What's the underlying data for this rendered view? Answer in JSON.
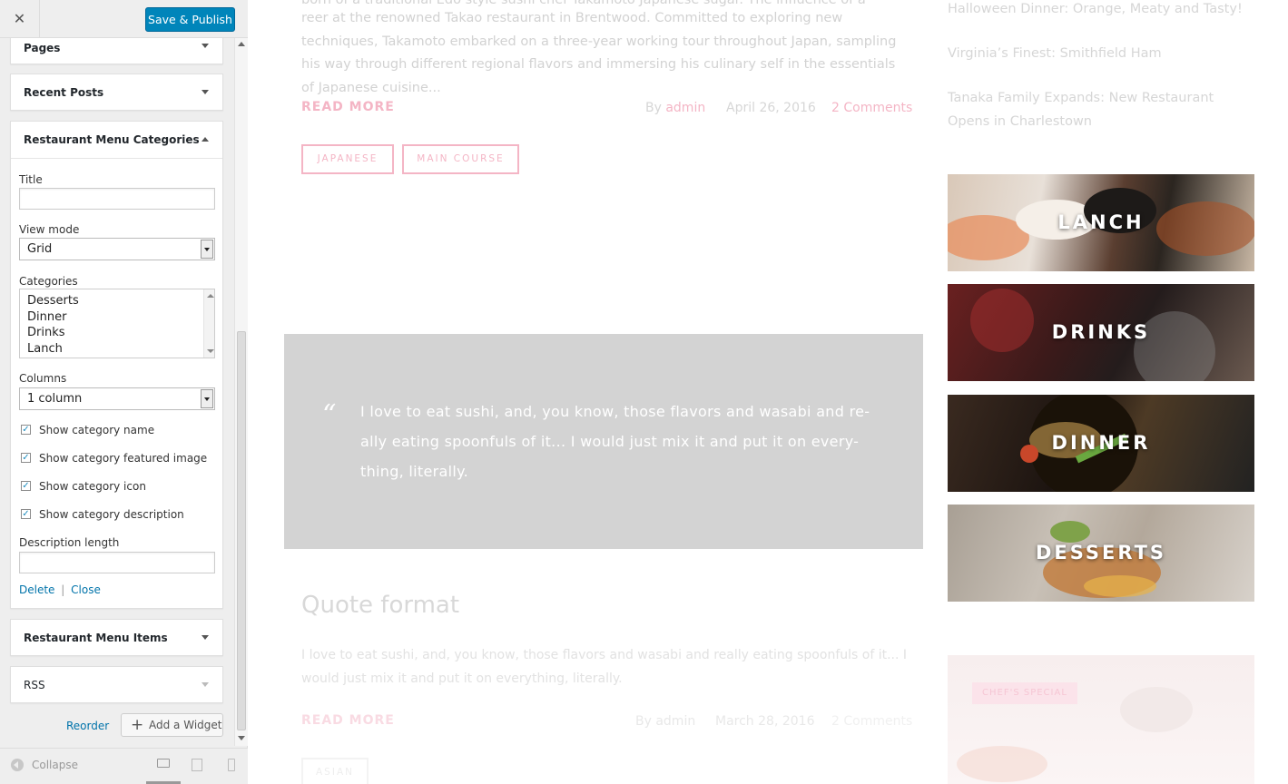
{
  "panel": {
    "close_icon": "close-icon",
    "save_label": "Save & Publish",
    "widgets": {
      "pages": "Pages",
      "recent_posts": "Recent Posts",
      "rmc": "Restaurant Menu Categories",
      "rmi": "Restaurant Menu Items",
      "rss": "RSS"
    },
    "form": {
      "title_label": "Title",
      "title_value": "",
      "view_mode_label": "View mode",
      "view_mode_value": "Grid",
      "categories_label": "Categories",
      "categories": [
        "Desserts",
        "Dinner",
        "Drinks",
        "Lanch"
      ],
      "columns_label": "Columns",
      "columns_value": "1 column",
      "checkboxes": [
        {
          "label": "Show category name",
          "checked": true
        },
        {
          "label": "Show category featured image",
          "checked": true
        },
        {
          "label": "Show category icon",
          "checked": true
        },
        {
          "label": "Show category description",
          "checked": true
        }
      ],
      "desc_length_label": "Description length",
      "desc_length_value": "",
      "delete_label": "Delete",
      "separator": "|",
      "close_label": "Close"
    },
    "reorder_label": "Reorder",
    "add_widget_label": "Add a Widget",
    "collapse_label": "Collapse",
    "device_icons": [
      "desktop-icon",
      "tablet-icon",
      "mobile-icon"
    ]
  },
  "preview": {
    "post1": {
      "excerpt_top": "born of a traditional Edo style sushi chef Takamoto Japanese sugar. The influence of a consecrated",
      "excerpt": "reer at the renowned Takao restaurant in Brentwood. Committed to exploring new techniques, Takamoto embarked on a three-year working tour throughout Japan, sampling his way through different regional flavors and immersing his culinary self in the essentials of Japanese cuisine...",
      "read_more": "READ MORE",
      "by": "By",
      "author": "admin",
      "date": "April 26, 2016",
      "comments": "2 Comments",
      "tags": [
        "JAPANESE",
        "MAIN COURSE"
      ]
    },
    "quote": {
      "mark": "“",
      "text": "I love to eat sushi, and, you know, those flavors and wasabi and re-ally eating spoonfuls of it... I would just mix it and put it on every-thing, literally."
    },
    "post2": {
      "title": "Quote format",
      "excerpt": "I love to eat sushi, and, you know, those flavors and wasabi and really eating spoonfuls of it... I would just mix it and put it on everything, literally.",
      "read_more": "READ MORE",
      "meta": "By admin",
      "date": "March 28, 2016",
      "comments": "2 Comments",
      "tag": "ASIAN"
    },
    "sidebar": {
      "links": [
        "Halloween Dinner: Orange, Meaty and Tasty!",
        "Virginia’s Finest: Smithfield Ham",
        "Tanaka Family Expands: New Restaurant Opens in Charlestown"
      ],
      "categories": [
        "LANCH",
        "DRINKS",
        "DINNER",
        "DESSERTS"
      ],
      "chefs_special": "CHEF'S SPECIAL"
    }
  },
  "colors": {
    "accent": "#0085ba",
    "pink": "#f4b5c5",
    "quote_bg": "#d3d3d3"
  }
}
